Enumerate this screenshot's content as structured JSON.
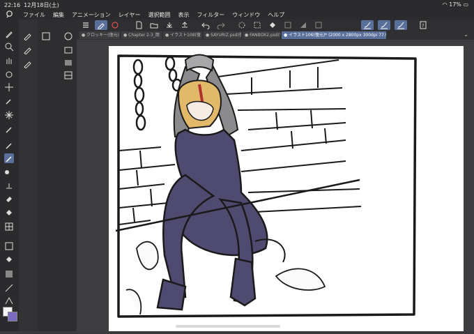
{
  "status_bar": {
    "time": "22:16",
    "date": "12月18日(土)",
    "battery": "17%"
  },
  "menu": {
    "items": [
      "ファイル",
      "編集",
      "アニメーション",
      "レイヤー",
      "選択範囲",
      "表示",
      "フィルター",
      "ウィンドウ",
      "ヘルプ"
    ]
  },
  "tabs": [
    {
      "label": "● クロッキー(復元)"
    },
    {
      "label": "● Chapter 2-3_簡"
    },
    {
      "label": "● イラスト108(復"
    },
    {
      "label": "● SAYURIZ.psd(復"
    },
    {
      "label": "● FANBOX2.psd(復"
    },
    {
      "label": "● イラスト106(復元)* (2000 x 2800px 300dpi 77.9%)"
    }
  ],
  "colors": {
    "accent": "#5a6f9a",
    "ui_dark": "#2b2b2d",
    "canvas_bg": "#ffffff",
    "dress": "#4f4a70",
    "hair": "#e2b869",
    "sketch_line": "#1a1a1a"
  },
  "tool_icons": [
    "pen-tool-icon",
    "magnifier-icon",
    "hand-icon",
    "rotate-icon",
    "move-icon",
    "eyedropper-icon",
    "sparkle-icon",
    "dropper-icon",
    "pencil-icon",
    "brush-icon",
    "airbrush-icon",
    "blend-icon",
    "eraser-icon",
    "fill-icon",
    "gradient-icon",
    "frame-icon",
    "bucket-icon",
    "figure-icon",
    "line-icon",
    "text-icon"
  ]
}
